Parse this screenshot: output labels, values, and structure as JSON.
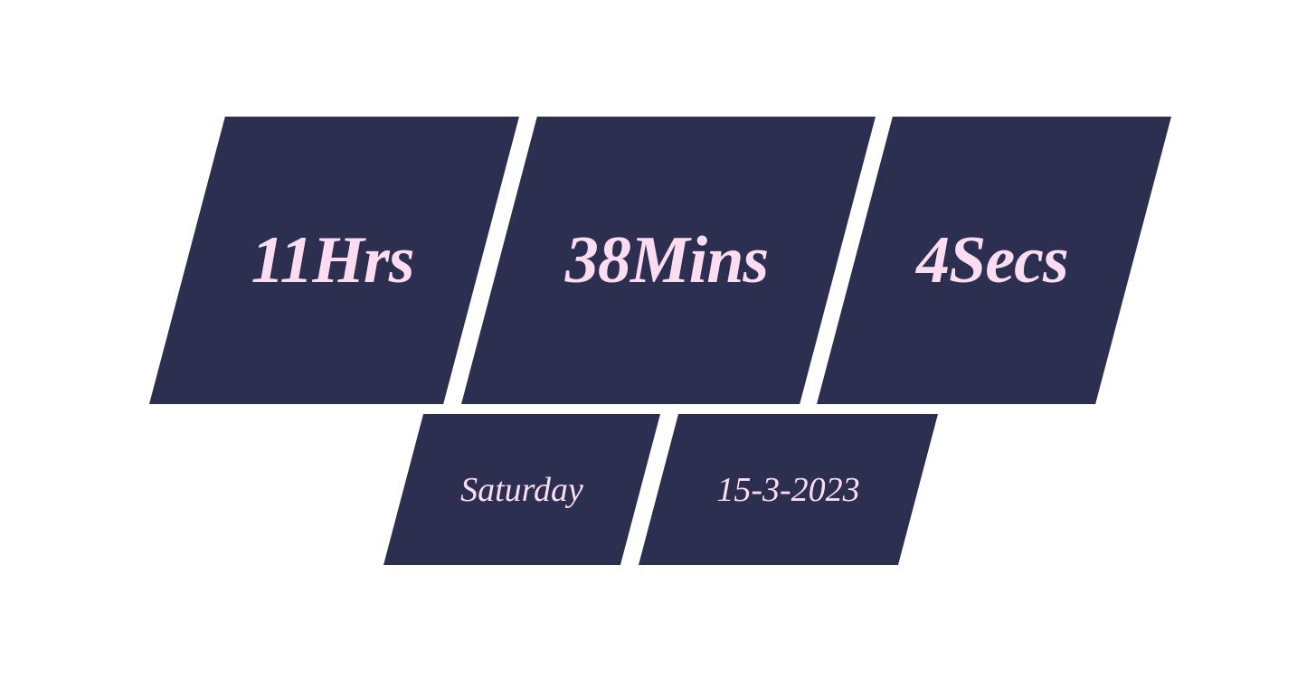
{
  "clock": {
    "hours": "11Hrs",
    "minutes": "38Mins",
    "seconds": "4Secs",
    "day": "Saturday",
    "date": "15-3-2023"
  },
  "colors": {
    "panel_background": "#2c2f50",
    "text": "#fbdcf0",
    "page_background": "#ffffff"
  }
}
